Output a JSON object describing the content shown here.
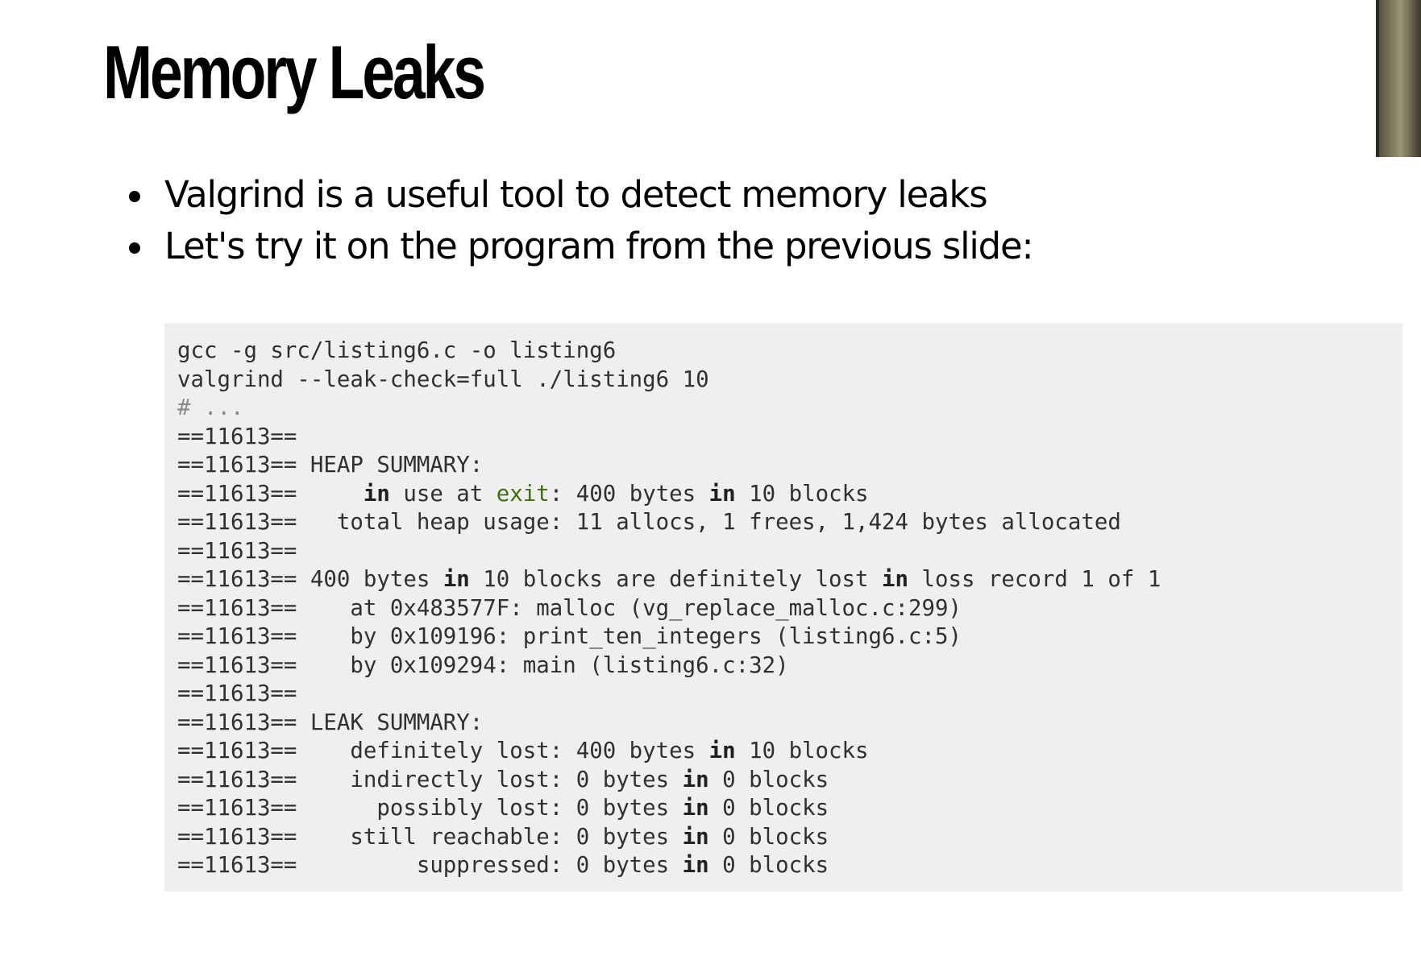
{
  "slide": {
    "title": "Memory Leaks",
    "bullets": [
      "Valgrind is a useful tool to detect memory leaks",
      "Let's try it on the program from the previous slide:"
    ]
  },
  "code": {
    "lines": [
      "gcc -g src/listing6.c -o listing6",
      "valgrind --leak-check=full ./listing6 10",
      "# ...",
      "==11613==",
      "==11613== HEAP SUMMARY:",
      "==11613==     in use at exit: 400 bytes in 10 blocks",
      "==11613==   total heap usage: 11 allocs, 1 frees, 1,424 bytes allocated",
      "==11613==",
      "==11613== 400 bytes in 10 blocks are definitely lost in loss record 1 of 1",
      "==11613==    at 0x483577F: malloc (vg_replace_malloc.c:299)",
      "==11613==    by 0x109196: print_ten_integers (listing6.c:5)",
      "==11613==    by 0x109294: main (listing6.c:32)",
      "==11613==",
      "==11613== LEAK SUMMARY:",
      "==11613==    definitely lost: 400 bytes in 10 blocks",
      "==11613==    indirectly lost: 0 bytes in 0 blocks",
      "==11613==      possibly lost: 0 bytes in 0 blocks",
      "==11613==    still reachable: 0 bytes in 0 blocks",
      "==11613==         suppressed: 0 bytes in 0 blocks"
    ]
  },
  "colors": {
    "code_background": "#efefef",
    "code_text": "#303030",
    "keyword_highlight": "#3f6e12"
  }
}
